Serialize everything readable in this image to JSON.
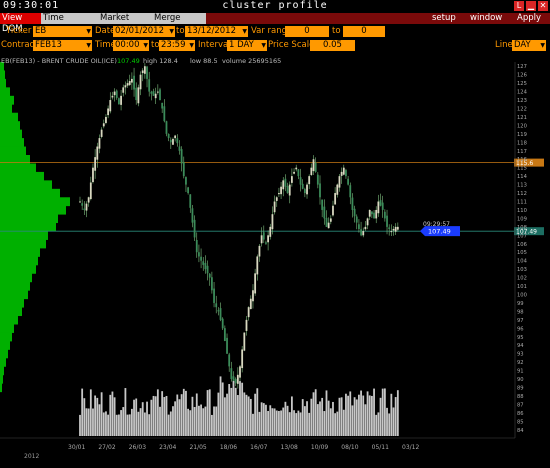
{
  "window": {
    "clock": "09:30:01",
    "title": "cluster profile"
  },
  "tabs": [
    "View DOM",
    "Time Interval",
    "Market Watch",
    "Merge Contr"
  ],
  "menu": {
    "setup": "setup",
    "window": "window",
    "apply": "Apply"
  },
  "params": {
    "ticker_label": "Ticker",
    "ticker": "EB",
    "date_label": "Date",
    "date_from": "02/01/2012",
    "date_to_label": "to",
    "date_to": "13/12/2012",
    "var_range_label": "Var range",
    "var_from": "0",
    "var_to_label": "to",
    "var_to": "0",
    "contract_label": "Contract",
    "contract": "FEB13",
    "time_label": "Time",
    "time_from": "00:00",
    "time_to_label": "to",
    "time_to": "23:59",
    "interval_label": "Interval",
    "interval": "1 DAY",
    "price_scale_label": "Price Scale",
    "price_scale": "0.05",
    "line_label": "Line",
    "line": "DAY"
  },
  "chart_header": {
    "symbol": "EB(FEB13) - BRENT CRUDE OIL(ICE)",
    "last": "107.49",
    "high": "high 128.4",
    "low": "low 88.5",
    "volume": "volume 25695165"
  },
  "colors": {
    "orange": "#ff9900",
    "green": "#00b000",
    "blue_marker": "#1a3cff",
    "teal_line": "#2a8a7a",
    "orange_line": "#c87814"
  },
  "chart_data": {
    "type": "candlestick",
    "year_label": "2012",
    "x_labels": [
      "30/01",
      "27/02",
      "26/03",
      "23/04",
      "21/05",
      "18/06",
      "16/07",
      "13/08",
      "10/09",
      "08/10",
      "05/11",
      "03/12"
    ],
    "y_ticks": [
      127,
      126,
      125,
      124,
      123,
      122,
      121,
      120,
      119,
      118,
      117,
      116,
      115,
      114,
      113,
      112,
      111,
      110,
      109,
      108,
      107,
      106,
      105,
      104,
      103,
      102,
      101,
      100,
      99,
      98,
      97,
      96,
      95,
      94,
      93,
      92,
      91,
      90,
      89,
      88,
      87,
      86,
      85,
      84
    ],
    "ylim": [
      83.5,
      127.5
    ],
    "close_path": [
      [
        0,
        111
      ],
      [
        2,
        110
      ],
      [
        4,
        111.5
      ],
      [
        6,
        115
      ],
      [
        8,
        117.5
      ],
      [
        10,
        119.5
      ],
      [
        12,
        121
      ],
      [
        14,
        123
      ],
      [
        16,
        124
      ],
      [
        18,
        122.5
      ],
      [
        20,
        124.5
      ],
      [
        22,
        125
      ],
      [
        24,
        125.5
      ],
      [
        26,
        123
      ],
      [
        28,
        126
      ],
      [
        30,
        127
      ],
      [
        32,
        124
      ],
      [
        34,
        123.5
      ],
      [
        36,
        124
      ],
      [
        38,
        122
      ],
      [
        40,
        119
      ],
      [
        42,
        118
      ],
      [
        44,
        118.8
      ],
      [
        46,
        117
      ],
      [
        48,
        114
      ],
      [
        50,
        112
      ],
      [
        52,
        108.5
      ],
      [
        54,
        105
      ],
      [
        56,
        104
      ],
      [
        58,
        103
      ],
      [
        60,
        102
      ],
      [
        62,
        99
      ],
      [
        64,
        98
      ],
      [
        66,
        96
      ],
      [
        68,
        93
      ],
      [
        70,
        90
      ],
      [
        72,
        89.5
      ],
      [
        74,
        91.5
      ],
      [
        76,
        95.5
      ],
      [
        78,
        98.5
      ],
      [
        80,
        100.5
      ],
      [
        82,
        104.5
      ],
      [
        84,
        107
      ],
      [
        86,
        106
      ],
      [
        88,
        108
      ],
      [
        90,
        111
      ],
      [
        92,
        112
      ],
      [
        94,
        113.5
      ],
      [
        96,
        112
      ],
      [
        98,
        114
      ],
      [
        100,
        115
      ],
      [
        102,
        113
      ],
      [
        104,
        112
      ],
      [
        106,
        114
      ],
      [
        108,
        116
      ],
      [
        110,
        113
      ],
      [
        112,
        110
      ],
      [
        114,
        108
      ],
      [
        116,
        109
      ],
      [
        118,
        112
      ],
      [
        120,
        114
      ],
      [
        122,
        115
      ],
      [
        124,
        113
      ],
      [
        126,
        110
      ],
      [
        128,
        108.5
      ],
      [
        130,
        107
      ],
      [
        132,
        108
      ],
      [
        134,
        110
      ],
      [
        136,
        109
      ],
      [
        138,
        111
      ],
      [
        140,
        110
      ],
      [
        142,
        108
      ],
      [
        144,
        107.5
      ],
      [
        146,
        108
      ]
    ],
    "horizontal_lines": [
      {
        "label": "115.6",
        "value": 115.6
      },
      {
        "label": "107.49",
        "value": 107.49
      }
    ],
    "time_marker": "09:29:57",
    "price_marker": "107.49",
    "volume_profile": [
      [
        127,
        4
      ],
      [
        126,
        5
      ],
      [
        125,
        6
      ],
      [
        124,
        10
      ],
      [
        123,
        14
      ],
      [
        122,
        12
      ],
      [
        121,
        18
      ],
      [
        120,
        20
      ],
      [
        119,
        22
      ],
      [
        118,
        24
      ],
      [
        117,
        26
      ],
      [
        116,
        30
      ],
      [
        115,
        36
      ],
      [
        114,
        44
      ],
      [
        113,
        52
      ],
      [
        112,
        60
      ],
      [
        111,
        70
      ],
      [
        110,
        66
      ],
      [
        109,
        58
      ],
      [
        108,
        56
      ],
      [
        107,
        48
      ],
      [
        106,
        46
      ],
      [
        105,
        40
      ],
      [
        104,
        38
      ],
      [
        103,
        36
      ],
      [
        102,
        32
      ],
      [
        101,
        30
      ],
      [
        100,
        28
      ],
      [
        99,
        24
      ],
      [
        98,
        22
      ],
      [
        97,
        18
      ],
      [
        96,
        14
      ],
      [
        95,
        12
      ],
      [
        94,
        10
      ],
      [
        93,
        8
      ],
      [
        92,
        6
      ],
      [
        91,
        4
      ],
      [
        90,
        3
      ],
      [
        89,
        2
      ]
    ]
  }
}
